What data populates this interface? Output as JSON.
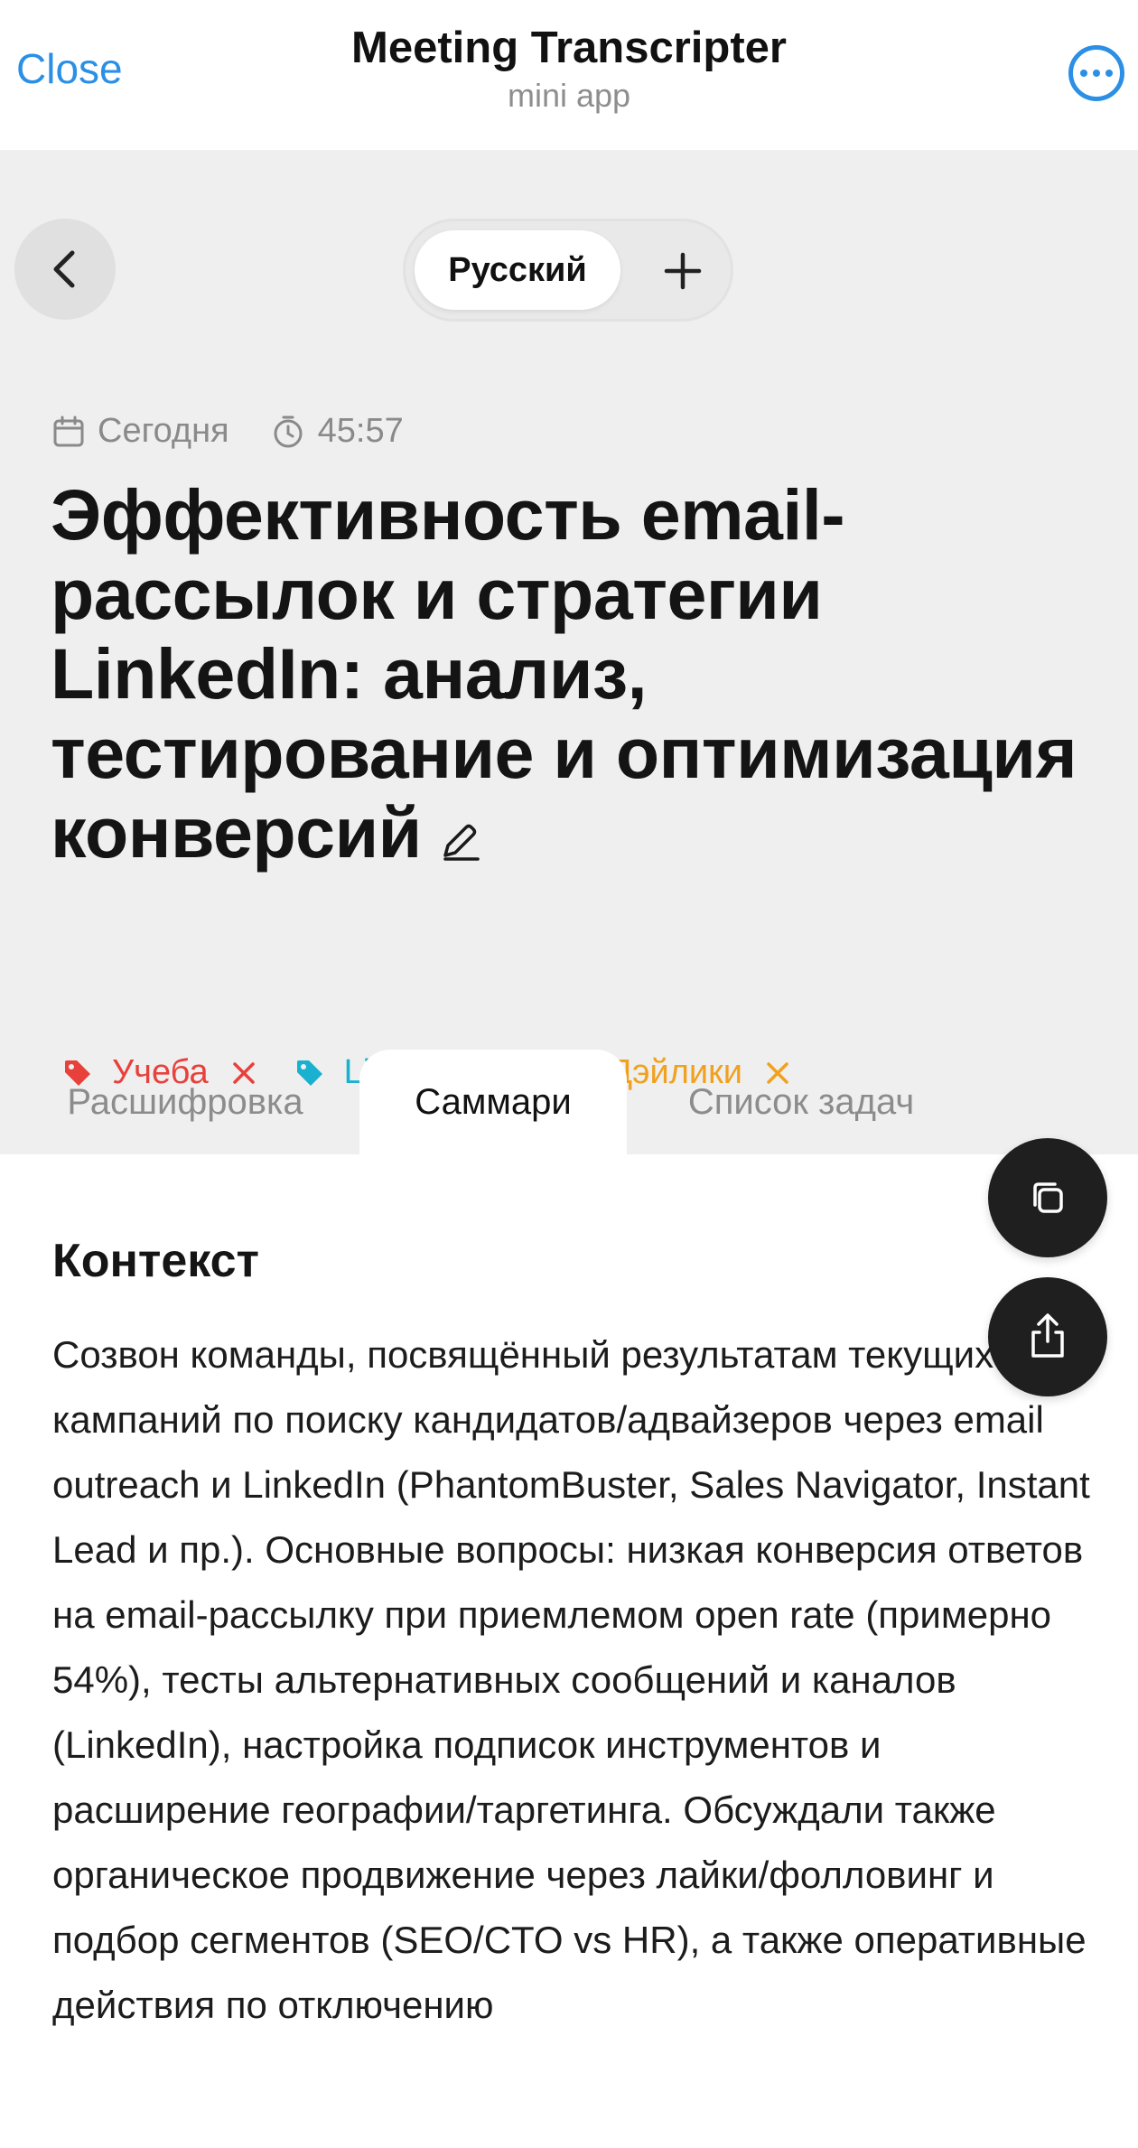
{
  "header": {
    "close_label": "Close",
    "title": "Meeting Transcripter",
    "subtitle": "mini app",
    "more_icon": "more-horizontal-icon"
  },
  "language": {
    "selected": "Русский",
    "add_icon": "plus-icon"
  },
  "meta": {
    "date": "Сегодня",
    "duration": "45:57"
  },
  "meeting": {
    "title": "Эффективность email-рассылок и стратегии LinkedIn: анализ, тестирование и оптимизация конверсий"
  },
  "tags": [
    {
      "label": "Учеба",
      "color": "#e8403b"
    },
    {
      "label": "LinkedIn",
      "color": "#1ab0d0"
    },
    {
      "label": "Дэйлики",
      "color": "#f0a11f"
    }
  ],
  "tabs": [
    {
      "label": "Расшифровка",
      "active": false
    },
    {
      "label": "Саммари",
      "active": true
    },
    {
      "label": "Список задач",
      "active": false
    }
  ],
  "summary": {
    "heading": "Контекст",
    "text": "Созвон команды, посвящённый результатам текущих кампаний по поиску кандидатов/адвайзеров через email outreach и LinkedIn (PhantomBuster, Sales Navigator, Instant Lead и пр.). Основные вопросы: низкая конверсия ответов на email-рассылку при приемлемом open rate (примерно 54%), тесты альтернативных сообщений и каналов (LinkedIn), настройка подписок инструментов и расширение географии/таргетинга. Обсуждали также органическое продвижение через лайки/фолловинг и подбор сегментов (SEO/CTO vs HR), а также оперативные действия по отключению"
  },
  "actions": {
    "copy_icon": "copy-icon",
    "share_icon": "share-icon"
  },
  "colors": {
    "accent": "#2b8fe6",
    "gray_background": "#efefef",
    "fab_background": "#1f1f1f"
  }
}
